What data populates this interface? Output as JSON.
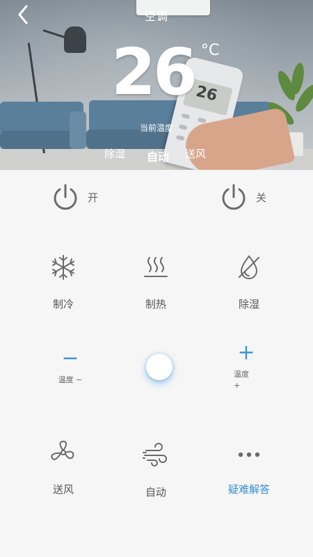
{
  "header": {
    "title": "空调"
  },
  "display": {
    "temperature": "26",
    "unit": "°C",
    "current_label": "当前温度"
  },
  "modes": [
    {
      "label": "除湿",
      "active": false
    },
    {
      "label": "自动",
      "active": true
    },
    {
      "label": "送风",
      "active": false
    }
  ],
  "power": {
    "on_label": "开",
    "off_label": "关"
  },
  "controls": {
    "cool": {
      "label": "制冷",
      "icon": "snowflake-icon"
    },
    "heat": {
      "label": "制热",
      "icon": "heat-waves-icon"
    },
    "dehumidify": {
      "label": "除湿",
      "icon": "dehumidify-icon"
    },
    "temp_down": {
      "sign": "−",
      "label": "温度 −"
    },
    "temp_up": {
      "sign": "+",
      "label_line1": "温度",
      "label_line2": "+"
    },
    "fan": {
      "label": "送风",
      "icon": "fan-icon"
    },
    "auto": {
      "label": "自动",
      "icon": "wind-icon"
    },
    "faq": {
      "label": "疑难解答",
      "icon": "more-dots-icon"
    }
  },
  "colors": {
    "accent": "#3c97db",
    "faq_text": "#3a8fd1",
    "icon_gray": "#6b6b6b",
    "background": "#f6f6f6"
  }
}
